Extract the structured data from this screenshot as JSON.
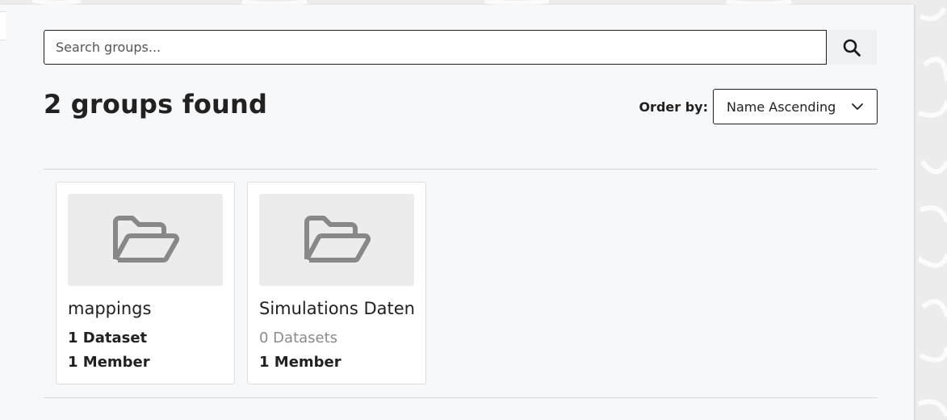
{
  "search": {
    "placeholder": "Search groups...",
    "value": "",
    "button_icon": "search-icon"
  },
  "results": {
    "title": "2 groups found"
  },
  "order": {
    "label": "Order by:",
    "selected": "Name Ascending",
    "icon": "chevron-down-icon"
  },
  "groups": [
    {
      "name": "mappings",
      "datasets": "1 Dataset",
      "members": "1 Member",
      "icon": "folder-open-icon"
    },
    {
      "name": "Simulations Daten",
      "datasets": "0 Datasets",
      "members": "1 Member",
      "icon": "folder-open-icon"
    }
  ],
  "colors": {
    "panel_bg": "#f7f8fa",
    "card_image_bg": "#ececec",
    "icon_gray": "#888888",
    "muted_text": "#8a8a8a"
  }
}
